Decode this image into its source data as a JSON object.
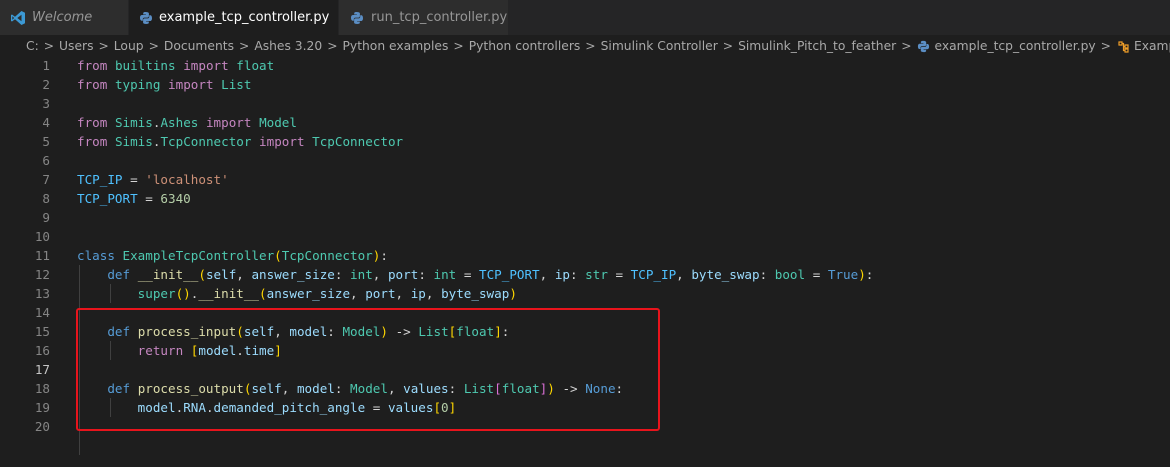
{
  "tabs": [
    {
      "label": "Welcome",
      "icon": "vscode-icon",
      "active": false,
      "italic": true
    },
    {
      "label": "example_tcp_controller.py",
      "icon": "python-icon",
      "active": true,
      "close": "×"
    },
    {
      "label": "run_tcp_controller.py",
      "icon": "python-icon",
      "active": false
    }
  ],
  "breadcrumb": {
    "items": [
      "C:",
      "Users",
      "Loup",
      "Documents",
      "Ashes 3.20",
      "Python examples",
      "Python controllers",
      "Simulink Controller",
      "Simulink_Pitch_to_feather",
      "example_tcp_controller.py",
      "ExampleTcpController"
    ],
    "file_icon": "python-icon",
    "symbol_icon": "class-icon",
    "separator": ">"
  },
  "editor": {
    "current_line": 17,
    "line_numbers": [
      "1",
      "2",
      "3",
      "4",
      "5",
      "6",
      "7",
      "8",
      "9",
      "10",
      "11",
      "12",
      "13",
      "14",
      "15",
      "16",
      "17",
      "18",
      "19",
      "20"
    ],
    "lines": [
      [
        [
          "kw",
          "from"
        ],
        [
          "op",
          " "
        ],
        [
          "cls",
          "builtins"
        ],
        [
          "op",
          " "
        ],
        [
          "kw",
          "import"
        ],
        [
          "op",
          " "
        ],
        [
          "cls",
          "float"
        ]
      ],
      [
        [
          "kw",
          "from"
        ],
        [
          "op",
          " "
        ],
        [
          "cls",
          "typing"
        ],
        [
          "op",
          " "
        ],
        [
          "kw",
          "import"
        ],
        [
          "op",
          " "
        ],
        [
          "cls",
          "List"
        ]
      ],
      [],
      [
        [
          "kw",
          "from"
        ],
        [
          "op",
          " "
        ],
        [
          "cls",
          "Simis"
        ],
        [
          "op",
          "."
        ],
        [
          "cls",
          "Ashes"
        ],
        [
          "op",
          " "
        ],
        [
          "kw",
          "import"
        ],
        [
          "op",
          " "
        ],
        [
          "cls",
          "Model"
        ]
      ],
      [
        [
          "kw",
          "from"
        ],
        [
          "op",
          " "
        ],
        [
          "cls",
          "Simis"
        ],
        [
          "op",
          "."
        ],
        [
          "cls",
          "TcpConnector"
        ],
        [
          "op",
          " "
        ],
        [
          "kw",
          "import"
        ],
        [
          "op",
          " "
        ],
        [
          "cls",
          "TcpConnector"
        ]
      ],
      [],
      [
        [
          "cst",
          "TCP_IP"
        ],
        [
          "op",
          " = "
        ],
        [
          "str",
          "'localhost'"
        ]
      ],
      [
        [
          "cst",
          "TCP_PORT"
        ],
        [
          "op",
          " = "
        ],
        [
          "num",
          "6340"
        ]
      ],
      [],
      [],
      [
        [
          "kd",
          "class"
        ],
        [
          "op",
          " "
        ],
        [
          "cls",
          "ExampleTcpController"
        ],
        [
          "br1",
          "("
        ],
        [
          "cls",
          "TcpConnector"
        ],
        [
          "br1",
          ")"
        ],
        [
          "op",
          ":"
        ]
      ],
      [
        [
          "op",
          "    "
        ],
        [
          "kd",
          "def"
        ],
        [
          "op",
          " "
        ],
        [
          "fn",
          "__init__"
        ],
        [
          "br1",
          "("
        ],
        [
          "var",
          "self"
        ],
        [
          "op",
          ", "
        ],
        [
          "var",
          "answer_size"
        ],
        [
          "op",
          ": "
        ],
        [
          "cls",
          "int"
        ],
        [
          "op",
          ", "
        ],
        [
          "var",
          "port"
        ],
        [
          "op",
          ": "
        ],
        [
          "cls",
          "int"
        ],
        [
          "op",
          " = "
        ],
        [
          "cst",
          "TCP_PORT"
        ],
        [
          "op",
          ", "
        ],
        [
          "var",
          "ip"
        ],
        [
          "op",
          ": "
        ],
        [
          "cls",
          "str"
        ],
        [
          "op",
          " = "
        ],
        [
          "cst",
          "TCP_IP"
        ],
        [
          "op",
          ", "
        ],
        [
          "var",
          "byte_swap"
        ],
        [
          "op",
          ": "
        ],
        [
          "cls",
          "bool"
        ],
        [
          "op",
          " = "
        ],
        [
          "kd",
          "True"
        ],
        [
          "br1",
          ")"
        ],
        [
          "op",
          ":"
        ]
      ],
      [
        [
          "op",
          "        "
        ],
        [
          "cls",
          "super"
        ],
        [
          "br1",
          "()"
        ],
        [
          "op",
          "."
        ],
        [
          "fn",
          "__init__"
        ],
        [
          "br1",
          "("
        ],
        [
          "var",
          "answer_size"
        ],
        [
          "op",
          ", "
        ],
        [
          "var",
          "port"
        ],
        [
          "op",
          ", "
        ],
        [
          "var",
          "ip"
        ],
        [
          "op",
          ", "
        ],
        [
          "var",
          "byte_swap"
        ],
        [
          "br1",
          ")"
        ]
      ],
      [],
      [
        [
          "op",
          "    "
        ],
        [
          "kd",
          "def"
        ],
        [
          "op",
          " "
        ],
        [
          "fn",
          "process_input"
        ],
        [
          "br1",
          "("
        ],
        [
          "var",
          "self"
        ],
        [
          "op",
          ", "
        ],
        [
          "var",
          "model"
        ],
        [
          "op",
          ": "
        ],
        [
          "cls",
          "Model"
        ],
        [
          "br1",
          ")"
        ],
        [
          "op",
          " -> "
        ],
        [
          "cls",
          "List"
        ],
        [
          "br1",
          "["
        ],
        [
          "cls",
          "float"
        ],
        [
          "br1",
          "]"
        ],
        [
          "op",
          ":"
        ]
      ],
      [
        [
          "op",
          "        "
        ],
        [
          "kw",
          "return"
        ],
        [
          "op",
          " "
        ],
        [
          "br1",
          "["
        ],
        [
          "var",
          "model"
        ],
        [
          "op",
          "."
        ],
        [
          "var",
          "time"
        ],
        [
          "br1",
          "]"
        ]
      ],
      [],
      [
        [
          "op",
          "    "
        ],
        [
          "kd",
          "def"
        ],
        [
          "op",
          " "
        ],
        [
          "fn",
          "process_output"
        ],
        [
          "br1",
          "("
        ],
        [
          "var",
          "self"
        ],
        [
          "op",
          ", "
        ],
        [
          "var",
          "model"
        ],
        [
          "op",
          ": "
        ],
        [
          "cls",
          "Model"
        ],
        [
          "op",
          ", "
        ],
        [
          "var",
          "values"
        ],
        [
          "op",
          ": "
        ],
        [
          "cls",
          "List"
        ],
        [
          "br2",
          "["
        ],
        [
          "cls",
          "float"
        ],
        [
          "br2",
          "]"
        ],
        [
          "br1",
          ")"
        ],
        [
          "op",
          " -> "
        ],
        [
          "kd",
          "None"
        ],
        [
          "op",
          ":"
        ]
      ],
      [
        [
          "op",
          "        "
        ],
        [
          "var",
          "model"
        ],
        [
          "op",
          "."
        ],
        [
          "var",
          "RNA"
        ],
        [
          "op",
          "."
        ],
        [
          "var",
          "demanded_pitch_angle"
        ],
        [
          "op",
          " = "
        ],
        [
          "var",
          "values"
        ],
        [
          "br1",
          "["
        ],
        [
          "num",
          "0"
        ],
        [
          "br1",
          "]"
        ]
      ],
      []
    ]
  }
}
